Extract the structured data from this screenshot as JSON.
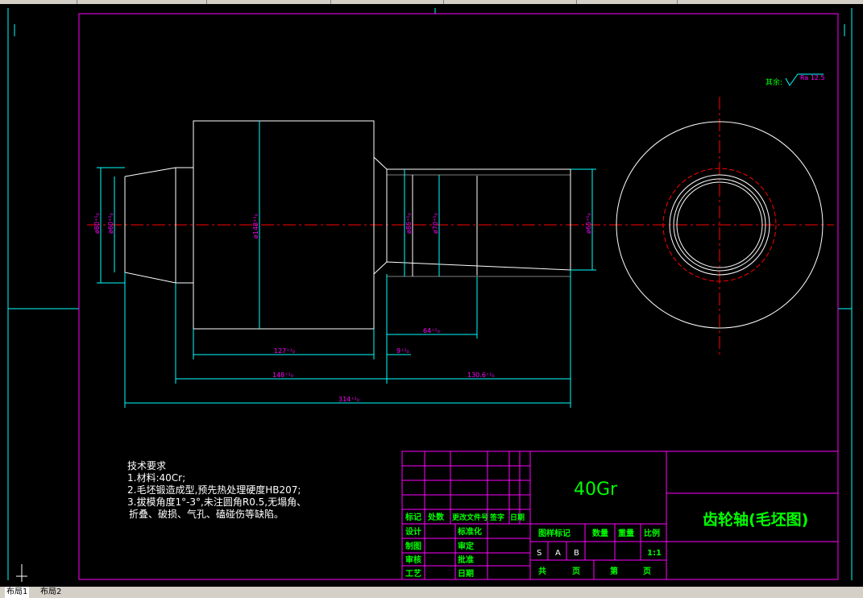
{
  "toolbar": {
    "segments": 6
  },
  "drawing": {
    "roughness_note_label": "其余:",
    "roughness_value": "Ra 12.5",
    "diameters": [
      "ø80⁺¹₀",
      "ø60⁺¹₀",
      "ø148⁺¹₀",
      "ø85⁺¹₀",
      "ø70⁺¹₀",
      "ø65⁺¹₀"
    ],
    "lengths": [
      "127⁺¹₀",
      "148⁺¹₀",
      "314⁺¹₀",
      "64⁺¹₀",
      "9⁺¹₀",
      "130.6⁺¹₀"
    ],
    "tech_req": {
      "title": "技术要求",
      "lines": [
        "1.材料:40Cr;",
        "2.毛坯锻造成型,预先热处理硬度HB207;",
        "3.拔模角度1°-3°,未注圆角R0.5,无塌角、",
        "折叠、破损、气孔、磕碰伤等缺陷。"
      ]
    },
    "title_block": {
      "material": "40Gr",
      "part_name": "齿轮轴(毛坯图)",
      "rev_headers": [
        "标记",
        "处数",
        "更改文件号",
        "签字",
        "日期"
      ],
      "roles": [
        "设计",
        "制图",
        "审核",
        "工艺"
      ],
      "roles2": [
        "标准化",
        "审定",
        "批准",
        "日期"
      ],
      "stage_headers": [
        "图样标记",
        "数量",
        "重量",
        "比例"
      ],
      "stage_marks": [
        "S",
        "A",
        "B"
      ],
      "scale": "1:1",
      "sheet_total": "共",
      "sheet_unit": "页",
      "sheet_no": "第",
      "sheet_unit2": "页"
    }
  },
  "layout_tabs": [
    "布局1",
    "布局2"
  ],
  "colors": {
    "bg": "#000000",
    "frame": "#ff00ff",
    "outline": "#ffffff",
    "dim": "#00ffff",
    "center": "#ff0000",
    "text": "#00ff00",
    "dimtext": "#ff00ff"
  }
}
